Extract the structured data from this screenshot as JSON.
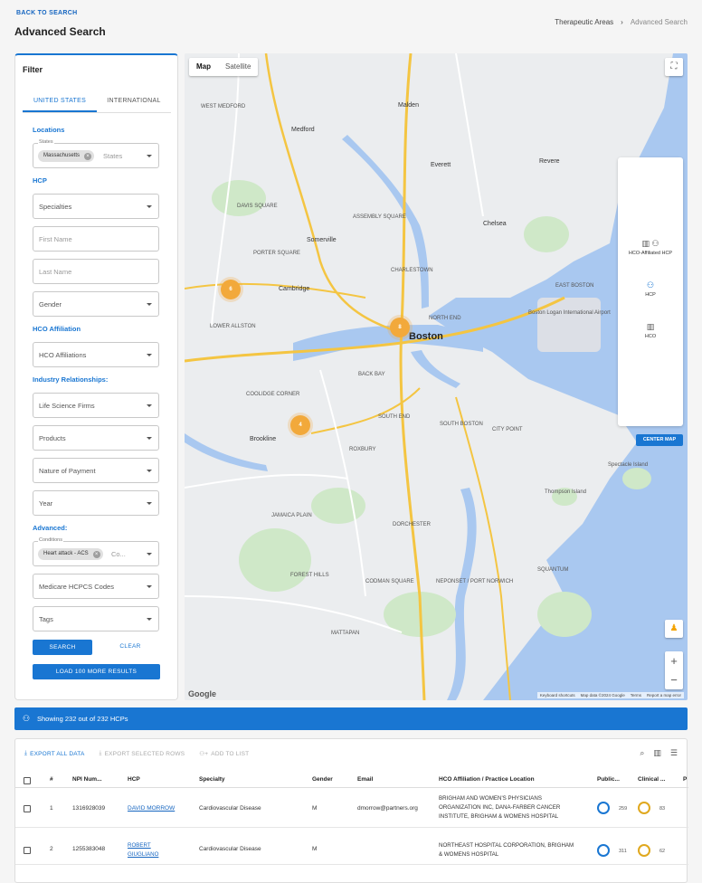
{
  "header": {
    "back_link": "BACK TO SEARCH",
    "title": "Advanced Search",
    "breadcrumbs": [
      "Therapeutic Areas",
      "Advanced Search"
    ],
    "breadcrumb_sep": "›"
  },
  "filter": {
    "title": "Filter",
    "tabs": [
      "UNITED STATES",
      "INTERNATIONAL"
    ],
    "active_tab": "UNITED STATES",
    "sections": {
      "locations": "Locations",
      "hcp": "HCP",
      "hco": "HCO Affiliation",
      "industry": "Industry Relationships:",
      "advanced": "Advanced:"
    },
    "states": {
      "legend": "States",
      "chip": "Massachusetts",
      "placeholder": "States"
    },
    "specialties": "Specialties",
    "first_name": "First Name",
    "last_name": "Last Name",
    "gender": "Gender",
    "hco_affiliations": "HCO Affiliations",
    "life_science_firms": "Life Science Firms",
    "products": "Products",
    "nature_of_payment": "Nature of Payment",
    "year": "Year",
    "conditions": {
      "legend": "Conditions",
      "chip": "Heart attack - ACS",
      "placeholder": "Co..."
    },
    "medicare": "Medicare HCPCS Codes",
    "tags": "Tags",
    "search_btn": "SEARCH",
    "clear_btn": "CLEAR",
    "load_btn": "LOAD 100 MORE RESULTS"
  },
  "map": {
    "types": [
      "Map",
      "Satellite"
    ],
    "active_type": "Map",
    "legend": [
      "HCO-Affiliated HCP",
      "HCP",
      "HCO"
    ],
    "center_btn": "CENTER MAP",
    "google": "Google",
    "attribution": [
      "Keyboard shortcuts",
      "Map data ©2024 Google",
      "Terms",
      "Report a map error"
    ],
    "clusters": [
      {
        "label": "6"
      },
      {
        "label": "8"
      },
      {
        "label": "4"
      }
    ],
    "labels": [
      "Boston",
      "Cambridge",
      "Somerville",
      "Chelsea",
      "Medford",
      "Malden",
      "Everett",
      "Revere",
      "CHARLESTOWN",
      "EAST BOSTON",
      "BACK BAY",
      "SOUTH END",
      "SOUTH BOSTON",
      "ROXBURY",
      "DORCHESTER",
      "JAMAICA PLAIN",
      "Brookline",
      "MATTAPAN",
      "SQUANTUM",
      "Thompson Island",
      "Spectacle Island",
      "Boston Logan International Airport",
      "NORTH END",
      "WEST MEDFORD",
      "DAVIS SQUARE",
      "PORTER SQUARE",
      "LOWER ALLSTON",
      "COOLIDGE CORNER",
      "FOREST HILLS",
      "CODMAN SQUARE",
      "NEPONSET / PORT NORWICH",
      "CITY POINT",
      "ASSEMBLY SQUARE"
    ]
  },
  "results": {
    "banner": "Showing 232 out of 232 HCPs",
    "toolbar": [
      "EXPORT ALL DATA",
      "EXPORT SELECTED ROWS",
      "ADD TO LIST"
    ],
    "columns": [
      "#",
      "NPI Num...",
      "HCP",
      "Specialty",
      "Gender",
      "Email",
      "HCO Affiliation / Practice Location",
      "Public...",
      "Clinical ...",
      "P"
    ],
    "rows": [
      {
        "n": "1",
        "npi": "1316928039",
        "hcp": "DAVID MORROW",
        "specialty": "Cardiovascular Disease",
        "gender": "M",
        "email": "dmorrow@partners.org",
        "hco": "BRIGHAM AND WOMEN'S PHYSICIANS ORGANIZATION INC, DANA-FARBER CANCER INSTITUTE, BRIGHAM & WOMENS HOSPITAL",
        "public": "259",
        "clinical": "83"
      },
      {
        "n": "2",
        "npi": "1255383048",
        "hcp": "ROBERT GIUGLIANO",
        "specialty": "Cardiovascular Disease",
        "gender": "M",
        "email": "",
        "hco": "NORTHEAST HOSPITAL CORPORATION, BRIGHAM & WOMENS HOSPITAL",
        "public": "311",
        "clinical": "62"
      }
    ]
  },
  "colors": {
    "primary": "#1976d2",
    "cluster": "#f2a93b",
    "ring_public": "#1976d2",
    "ring_clinical": "#e0a81e"
  }
}
